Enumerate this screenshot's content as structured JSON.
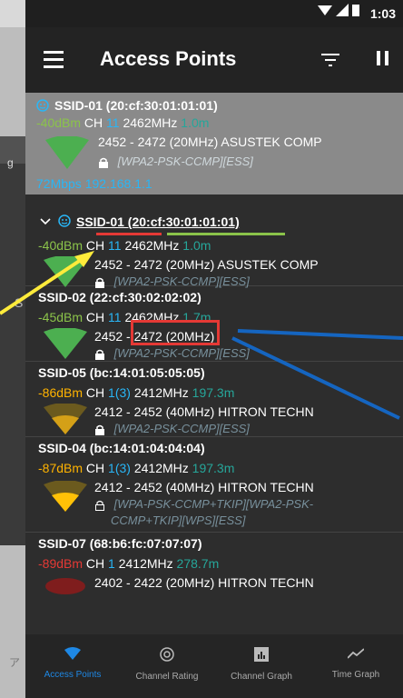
{
  "status": {
    "time": "1:03"
  },
  "appbar": {
    "title": "Access Points"
  },
  "background": {
    "left_frag1": "g",
    "left_frag2": "S",
    "bottom_frag": "ア"
  },
  "highlighted": {
    "name": "SSID-01 (20:cf:30:01:01:01)",
    "dbm": "-40dBm",
    "ch_label": "CH",
    "ch": "11",
    "freq": "2462MHz",
    "dist": "1.0m",
    "range": "2452 - 2472 (20MHz) ASUSTEK COMP",
    "security": "[WPA2-PSK-CCMP][ESS]",
    "rate": "72Mbps",
    "ip": "192.168.1.1"
  },
  "aps": [
    {
      "name": "SSID-01 (20:cf:30:01:01:01)",
      "dbm": "-40dBm",
      "ch_label": "CH",
      "ch": "11",
      "freq": "2462MHz",
      "dist": "1.0m",
      "range": "2452 - 2472 (20MHz) ASUSTEK COMP",
      "security": "[WPA2-PSK-CCMP][ESS]"
    },
    {
      "name": "SSID-02 (22:cf:30:02:02:02)",
      "dbm": "-45dBm",
      "ch_label": "CH",
      "ch": "11",
      "freq": "2462MHz",
      "dist": "1.7m",
      "range": "2452 - 2472 (20MHz)",
      "security": "[WPA2-PSK-CCMP][ESS]"
    },
    {
      "name": "SSID-05 (bc:14:01:05:05:05)",
      "dbm": "-86dBm",
      "ch_label": "CH",
      "ch": "1(3)",
      "freq": "2412MHz",
      "dist": "197.3m",
      "range": "2412 - 2452 (40MHz) HITRON TECHN",
      "security": "[WPA2-PSK-CCMP][ESS]"
    },
    {
      "name": "SSID-04 (bc:14:01:04:04:04)",
      "dbm": "-87dBm",
      "ch_label": "CH",
      "ch": "1(3)",
      "freq": "2412MHz",
      "dist": "197.3m",
      "range": "2412 - 2452 (40MHz) HITRON TECHN",
      "security1": "[WPA-PSK-CCMP+TKIP][WPA2-PSK-",
      "security2": "CCMP+TKIP][WPS][ESS]"
    },
    {
      "name": "SSID-07 (68:b6:fc:07:07:07)",
      "dbm": "-89dBm",
      "ch_label": "CH",
      "ch": "1",
      "freq": "2412MHz",
      "dist": "278.7m",
      "range": "2402 - 2422 (20MHz) HITRON TECHN"
    }
  ],
  "nav": [
    {
      "label": "Access Points",
      "icon": "wifi-icon"
    },
    {
      "label": "Channel Rating",
      "icon": "rating-icon"
    },
    {
      "label": "Channel Graph",
      "icon": "bar-graph-icon"
    },
    {
      "label": "Time Graph",
      "icon": "line-graph-icon"
    }
  ],
  "colors": {
    "accent": "#1e88e5",
    "strong": "#4caf50",
    "weak": "#c8a200",
    "very_weak": "#b71c1c"
  }
}
